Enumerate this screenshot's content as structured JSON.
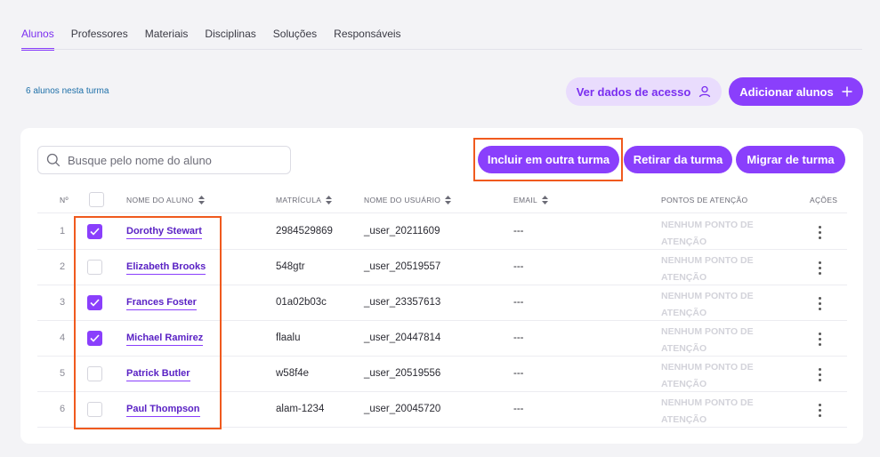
{
  "tabs": [
    {
      "label": "Alunos",
      "active": true
    },
    {
      "label": "Professores",
      "active": false
    },
    {
      "label": "Materiais",
      "active": false
    },
    {
      "label": "Disciplinas",
      "active": false
    },
    {
      "label": "Soluções",
      "active": false
    },
    {
      "label": "Responsáveis",
      "active": false
    }
  ],
  "student_count": "6 alunos nesta turma",
  "buttons": {
    "view_access": "Ver dados de acesso",
    "add_students": "Adicionar alunos",
    "include_other_class": "Incluir em outra turma",
    "remove_from_class": "Retirar da turma",
    "migrate_class": "Migrar de turma"
  },
  "search": {
    "placeholder": "Busque pelo nome do aluno",
    "value": ""
  },
  "table": {
    "headers": {
      "number": "Nº",
      "name": "NOME DO ALUNO",
      "enrollment": "MATRÍCULA",
      "username": "NOME DO USUÁRIO",
      "email": "EMAIL",
      "attention": "PONTOS DE ATENÇÃO",
      "actions": "AÇÕES"
    },
    "rows": [
      {
        "num": "1",
        "checked": true,
        "name": "Dorothy Stewart",
        "enrollment": "2984529869",
        "username": "_user_20211609",
        "email": "---",
        "attention_1": "NENHUM PONTO DE",
        "attention_2": "ATENÇÃO"
      },
      {
        "num": "2",
        "checked": false,
        "name": "Elizabeth Brooks",
        "enrollment": "548gtr",
        "username": "_user_20519557",
        "email": "---",
        "attention_1": "NENHUM PONTO DE",
        "attention_2": "ATENÇÃO"
      },
      {
        "num": "3",
        "checked": true,
        "name": "Frances Foster",
        "enrollment": "01a02b03c",
        "username": "_user_23357613",
        "email": "---",
        "attention_1": "NENHUM PONTO DE",
        "attention_2": "ATENÇÃO"
      },
      {
        "num": "4",
        "checked": true,
        "name": "Michael Ramirez",
        "enrollment": "flaalu",
        "username": "_user_20447814",
        "email": "---",
        "attention_1": "NENHUM PONTO DE",
        "attention_2": "ATENÇÃO"
      },
      {
        "num": "5",
        "checked": false,
        "name": "Patrick Butler",
        "enrollment": "w58f4e",
        "username": "_user_20519556",
        "email": "---",
        "attention_1": "NENHUM PONTO DE",
        "attention_2": "ATENÇÃO"
      },
      {
        "num": "6",
        "checked": false,
        "name": "Paul Thompson",
        "enrollment": "alam-1234",
        "username": "_user_20045720",
        "email": "---",
        "attention_1": "NENHUM PONTO DE",
        "attention_2": "ATENÇÃO"
      }
    ]
  },
  "colors": {
    "accent": "#8a3ffc",
    "accent_light": "#e9dcfd",
    "highlight": "#f05a1e",
    "link": "#5a22c4"
  },
  "icons": [
    "search-icon",
    "user-icon",
    "plus-icon",
    "sort-icon",
    "check-icon",
    "kebab-icon"
  ]
}
